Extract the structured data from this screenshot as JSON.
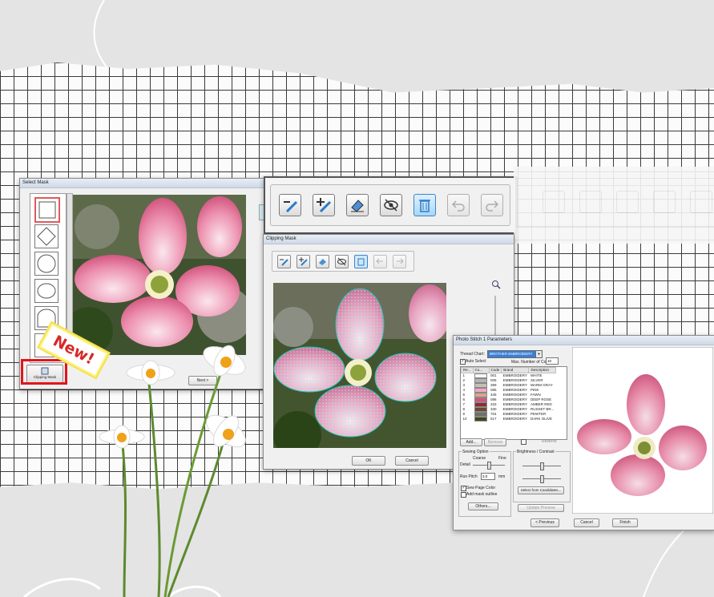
{
  "select_mask": {
    "title": "Select Mask",
    "next_label": "Next >",
    "clipping_mask_label": "Clipping Mask"
  },
  "new_badge": "New!",
  "clipping_mask": {
    "title": "Clipping Mask",
    "ok_label": "OK",
    "cancel_label": "Cancel"
  },
  "toolbar_icons": [
    "eraser-line-icon",
    "add-line-icon",
    "eraser-icon",
    "hide-icon",
    "delete-icon",
    "undo-icon",
    "redo-icon"
  ],
  "photo_stitch": {
    "title": "Photo Stitch 1 Parameters",
    "thread_chart_label": "Thread Chart:",
    "thread_chart_value": "BROTHER EMBROIDERY",
    "auto_select_label": "Auto Select",
    "max_colors_label": "Max. Number of Colors:",
    "max_colors_value": "10",
    "table_headers": [
      "Re...",
      "Co...",
      "Code",
      "Brand",
      "Description"
    ],
    "threads": [
      {
        "n": "1",
        "code": "001",
        "brand": "EMBROIDERY",
        "desc": "WHITE",
        "color": "#f6f6f6"
      },
      {
        "n": "2",
        "code": "005",
        "brand": "EMBROIDERY",
        "desc": "SILVER",
        "color": "#b5b5b5"
      },
      {
        "n": "3",
        "code": "399",
        "brand": "EMBROIDERY",
        "desc": "WARM GRAY",
        "color": "#c6bfb3"
      },
      {
        "n": "4",
        "code": "085",
        "brand": "EMBROIDERY",
        "desc": "PINK",
        "color": "#f2a8c0"
      },
      {
        "n": "5",
        "code": "345",
        "brand": "EMBROIDERY",
        "desc": "FAWN",
        "color": "#d9a58f"
      },
      {
        "n": "6",
        "code": "086",
        "brand": "EMBROIDERY",
        "desc": "DEEP ROSE",
        "color": "#d8537e"
      },
      {
        "n": "7",
        "code": "333",
        "brand": "EMBROIDERY",
        "desc": "AMBER RED",
        "color": "#8e2b36"
      },
      {
        "n": "8",
        "code": "330",
        "brand": "EMBROIDERY",
        "desc": "RUSSET BR...",
        "color": "#6b4a2a"
      },
      {
        "n": "9",
        "code": "704",
        "brand": "EMBROIDERY",
        "desc": "PEWTER",
        "color": "#6e6e6e"
      },
      {
        "n": "10",
        "code": "517",
        "brand": "EMBROIDERY",
        "desc": "DARK OLIVE",
        "color": "#3f4a1e"
      }
    ],
    "add_label": "Add...",
    "remove_label": "Remove",
    "reserve_label": "Reserve",
    "sewing_option_label": "Sewing Option",
    "coarse_label": "Coarse",
    "fine_label": "Fine",
    "detail_label": "Detail",
    "run_pitch_label": "Run Pitch",
    "run_pitch_value": "3.0",
    "run_pitch_unit": "mm",
    "sew_page_color_label": "Sew Page Color",
    "add_mask_outline_label": "Add mask outline",
    "others_label": "Others...",
    "brightness_label": "Brightness / Contrast",
    "select_candidates_label": "Select from Candidates...",
    "update_preview_label": "Update Preview",
    "previous_label": "< Previous",
    "cancel_label": "Cancel",
    "finish_label": "Finish"
  },
  "colors": {
    "badge_red": "#d62828",
    "badge_yellow": "#fff27a",
    "highlight_red": "#e3151c",
    "selected_blue": "#3a86c6"
  }
}
